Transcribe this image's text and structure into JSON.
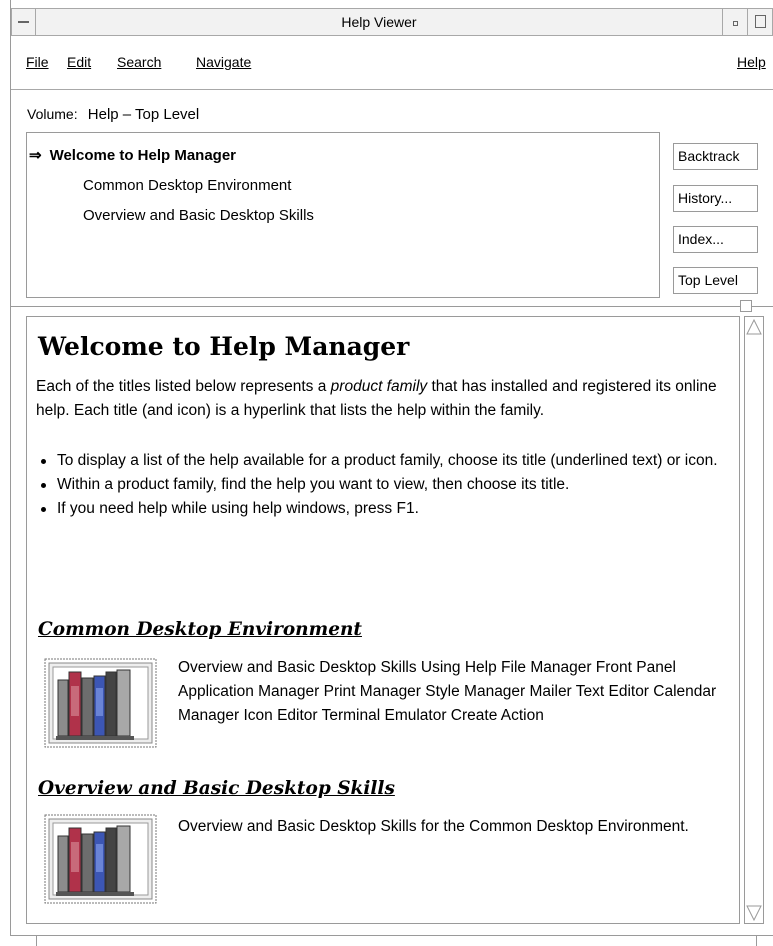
{
  "window": {
    "title": "Help Viewer"
  },
  "menubar": {
    "items": [
      {
        "label": "File"
      },
      {
        "label": "Edit"
      },
      {
        "label": "Search"
      },
      {
        "label": "Navigate"
      }
    ],
    "help_label": "Help"
  },
  "volume": {
    "label": "Volume:",
    "value": "Help – Top Level"
  },
  "topics": {
    "current_marker": "⇒",
    "items": [
      {
        "label": "Welcome to Help Manager",
        "current": true
      },
      {
        "label": "Common Desktop Environment",
        "current": false
      },
      {
        "label": "Overview and Basic Desktop Skills",
        "current": false
      }
    ]
  },
  "side_buttons": {
    "backtrack": "Backtrack",
    "history": "History...",
    "index": "Index...",
    "top_level": "Top Level"
  },
  "content": {
    "heading": "Welcome to Help Manager",
    "intro_before": "Each of the titles listed below represents a ",
    "intro_italic": "product family",
    "intro_after": " that has installed and registered its online help. Each title (and icon) is a hyperlink that lists the help within the family.",
    "bullets": [
      "To display a list of the help available for a product family, choose its title (underlined text) or icon.",
      "Within a product family, find the help you want to view, then choose its title.",
      "If you need help while using help windows, press F1."
    ],
    "sections": [
      {
        "title": "Common Desktop Environment",
        "icon": "book-shelf-icon",
        "description": "Overview and Basic Desktop Skills Using Help File Manager Front Panel Application Manager Print Manager Style Manager Mailer Text Editor Calendar Manager Icon Editor Terminal Emulator Create Action"
      },
      {
        "title": "Overview and Basic Desktop Skills",
        "icon": "book-shelf-icon",
        "description": "Overview and Basic Desktop Skills for the Common Desktop Environment."
      }
    ]
  },
  "colors": {
    "border": "#9a9a9a",
    "titlebar_bg": "#f2f2f2",
    "book_red": "#b0324a",
    "book_blue": "#3c56b4",
    "book_gray": "#8c8c8c"
  }
}
